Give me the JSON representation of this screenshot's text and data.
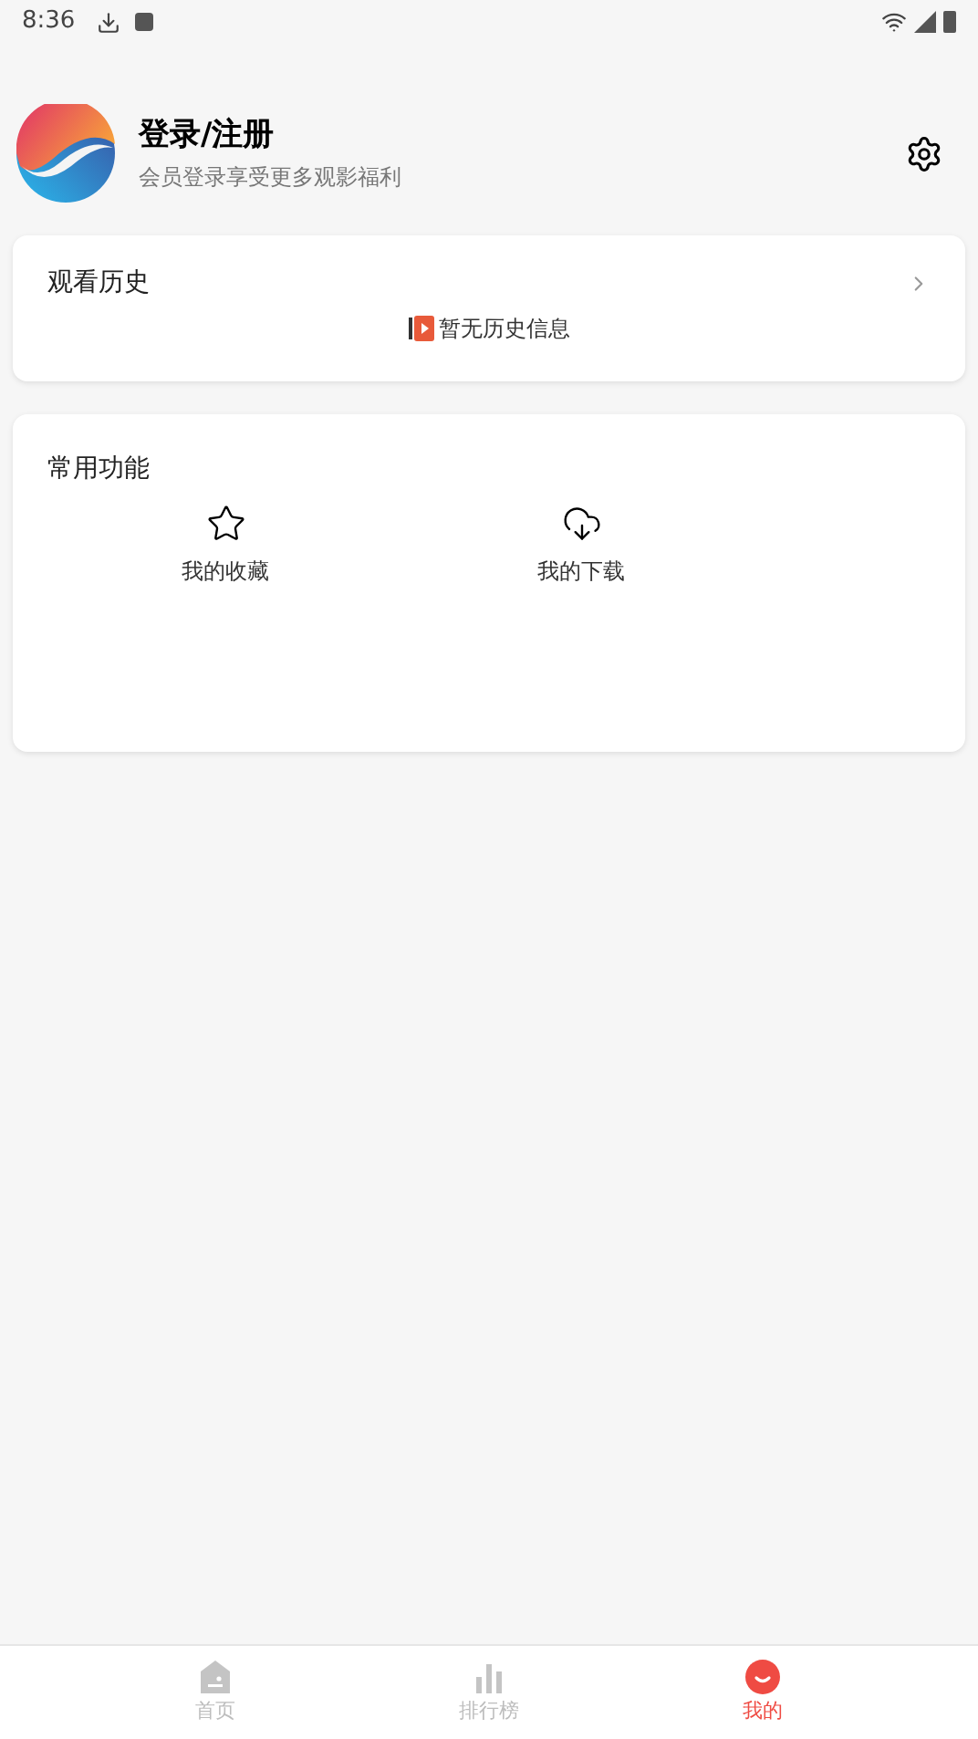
{
  "status_bar": {
    "time": "8:36"
  },
  "profile": {
    "title": "登录/注册",
    "subtitle": "会员登录享受更多观影福利"
  },
  "history": {
    "title": "观看历史",
    "empty_text": "暂无历史信息"
  },
  "features": {
    "title": "常用功能",
    "items": [
      {
        "kind": "favorites",
        "label": "我的收藏"
      },
      {
        "kind": "downloads",
        "label": "我的下载"
      }
    ]
  },
  "bottom_nav": [
    {
      "kind": "home",
      "label": "首页",
      "selected": false
    },
    {
      "kind": "ranking",
      "label": "排行榜",
      "selected": false
    },
    {
      "kind": "mine",
      "label": "我的",
      "selected": true
    }
  ]
}
